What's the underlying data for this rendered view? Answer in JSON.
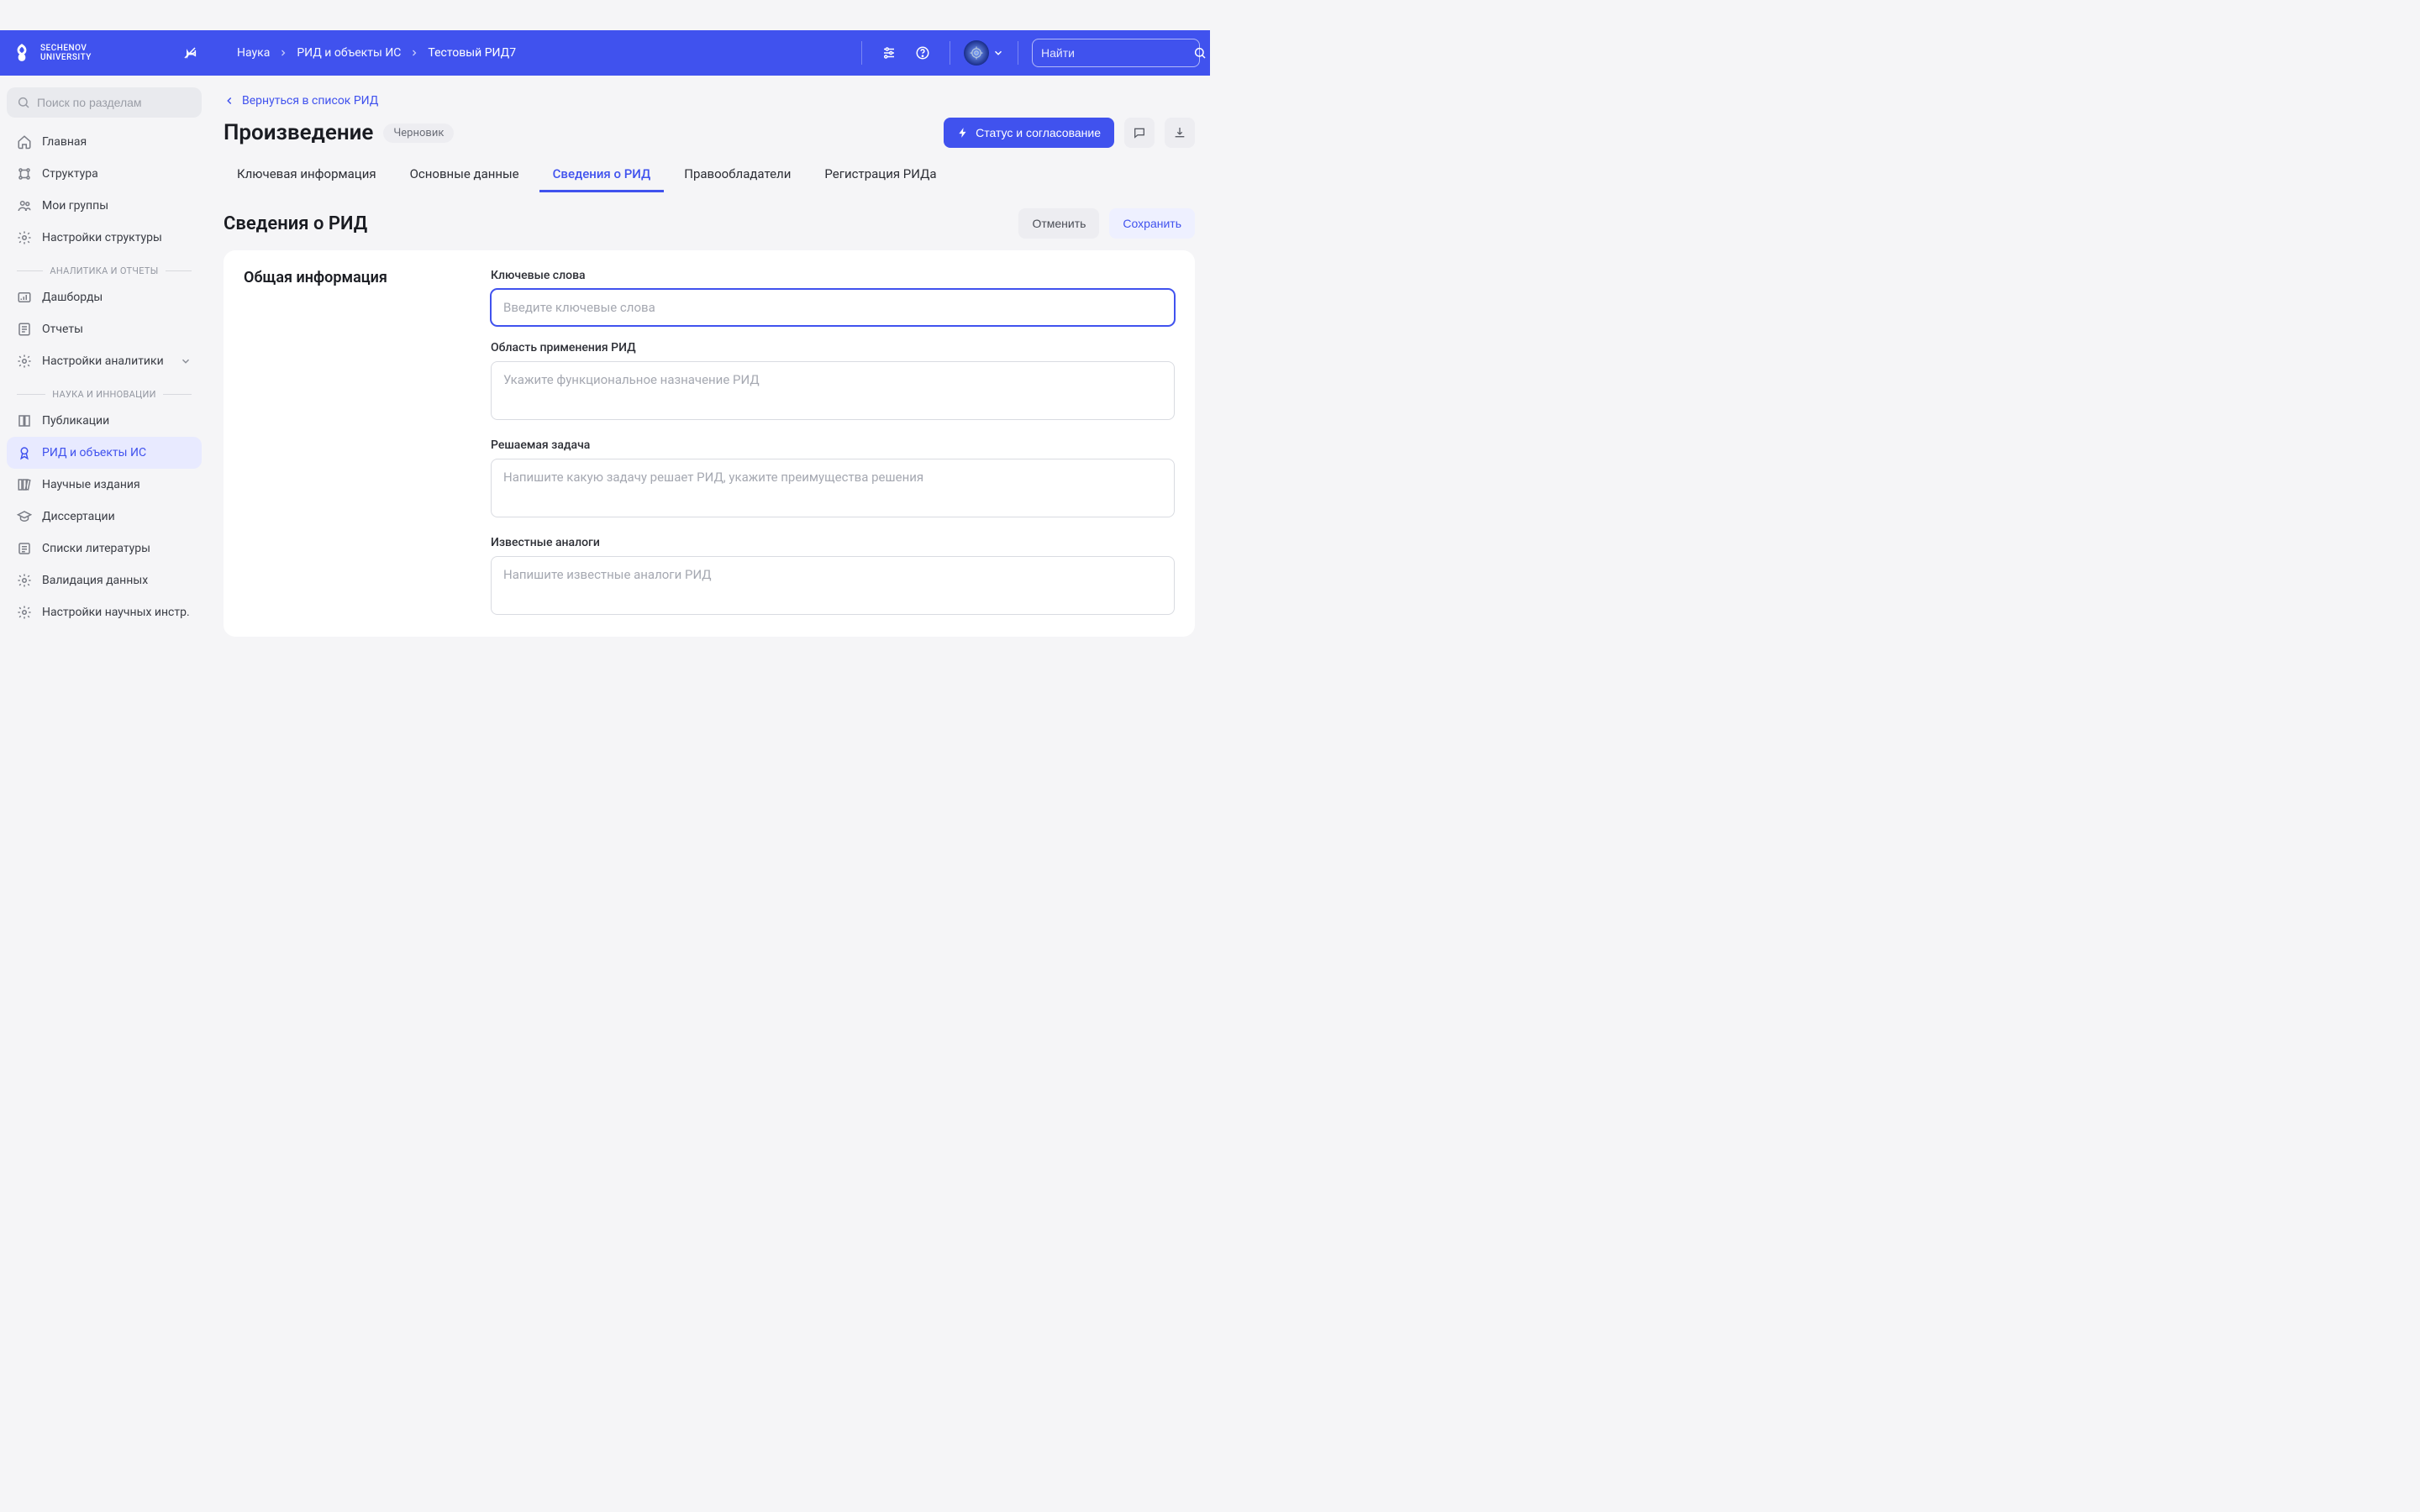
{
  "header": {
    "logo_line1": "SECHENOV",
    "logo_line2": "UNIVERSITY",
    "breadcrumb": [
      "Наука",
      "РИД и объекты ИС",
      "Тестовый РИД7"
    ],
    "search_placeholder": "Найти"
  },
  "sidebar": {
    "search_placeholder": "Поиск по разделам",
    "items_top": [
      {
        "label": "Главная",
        "icon": "home"
      },
      {
        "label": "Структура",
        "icon": "sitemap"
      },
      {
        "label": "Мои группы",
        "icon": "users"
      },
      {
        "label": "Настройки структуры",
        "icon": "gear"
      }
    ],
    "group1": "АНАЛИТИКА И ОТЧЕТЫ",
    "items_analytics": [
      {
        "label": "Дашборды",
        "icon": "dashboard"
      },
      {
        "label": "Отчеты",
        "icon": "report"
      },
      {
        "label": "Настройки аналитики",
        "icon": "gear",
        "chevron": true
      }
    ],
    "group2": "НАУКА И ИННОВАЦИИ",
    "items_science": [
      {
        "label": "Публикации",
        "icon": "book"
      },
      {
        "label": "РИД и объекты ИС",
        "icon": "award",
        "active": true
      },
      {
        "label": "Научные издания",
        "icon": "books"
      },
      {
        "label": "Диссертации",
        "icon": "graduation"
      },
      {
        "label": "Списки литературы",
        "icon": "list"
      },
      {
        "label": "Валидация данных",
        "icon": "gear"
      },
      {
        "label": "Настройки научных инстр.",
        "icon": "gear"
      }
    ]
  },
  "page": {
    "back_label": "Вернуться в список РИД",
    "title": "Произведение",
    "badge": "Черновик",
    "primary_action": "Статус и согласование",
    "tabs": [
      "Ключевая информация",
      "Основные данные",
      "Сведения о РИД",
      "Правообладатели",
      "Регистрация РИДа"
    ],
    "active_tab_index": 2,
    "section_title": "Сведения о РИД",
    "cancel_label": "Отменить",
    "save_label": "Сохранить",
    "form_section_title": "Общая информация",
    "fields": {
      "keywords": {
        "label": "Ключевые слова",
        "placeholder": "Введите ключевые слова",
        "value": ""
      },
      "scope": {
        "label": "Область применения РИД",
        "placeholder": "Укажите функциональное назначение РИД",
        "value": ""
      },
      "task": {
        "label": "Решаемая задача",
        "placeholder": "Напишите какую задачу решает РИД, укажите преимущества решения",
        "value": ""
      },
      "analogs": {
        "label": "Известные аналоги",
        "placeholder": "Напишите известные аналоги РИД",
        "value": ""
      }
    }
  }
}
